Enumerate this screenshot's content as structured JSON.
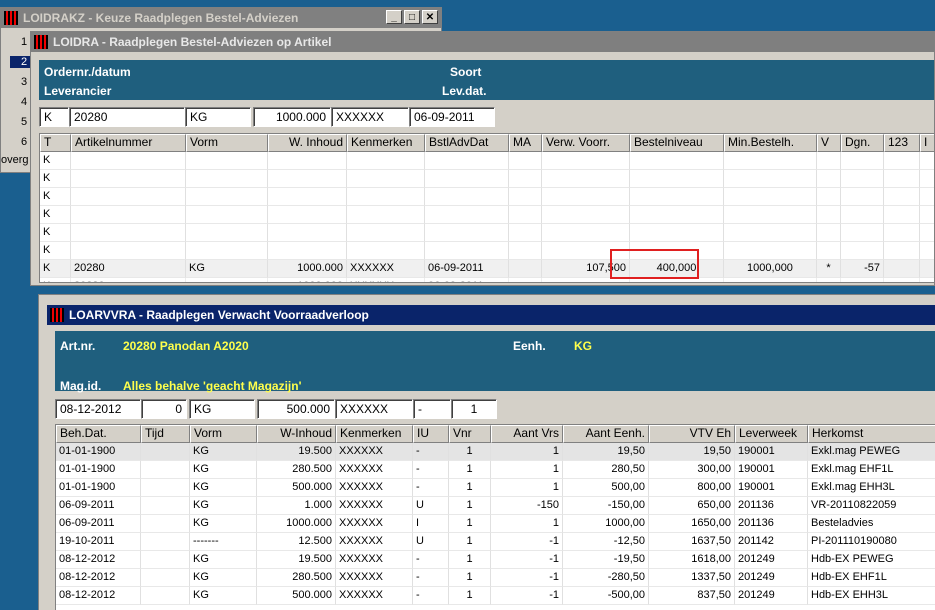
{
  "win_keuze": {
    "title": "LOIDRAKZ - Keuze Raadplegen Bestel-Adviezen",
    "side_numbers": [
      "1",
      "2",
      "3",
      "4",
      "5",
      "6"
    ],
    "side_text": "overg"
  },
  "win_loidra": {
    "title": "LOIDRA - Raadplegen Bestel-Adviezen op Artikel",
    "labels": {
      "ordernr": "Ordernr./datum",
      "leverancier": "Leverancier",
      "soort": "Soort",
      "levdat": "Lev.dat."
    },
    "fields": [
      "K",
      "20280",
      "KG",
      "1000.000",
      "XXXXXX",
      "06-09-2011"
    ],
    "columns": [
      "T",
      "Artikelnummer",
      "Vorm",
      "W. Inhoud",
      "Kenmerken",
      "BstlAdvDat",
      "MA",
      "Verw. Voorr.",
      "Bestelniveau",
      "Min.Bestelh.",
      "V",
      "Dgn.",
      "123",
      "I"
    ],
    "empty_rows": [
      "K",
      "K",
      "K",
      "K",
      "K",
      "K"
    ],
    "row": [
      "K",
      "20280",
      "KG",
      "1000.000",
      "XXXXXX",
      "06-09-2011",
      "",
      "107,500",
      "400,000",
      "1000,000",
      "*",
      "-57",
      "",
      ""
    ],
    "partial_row": [
      "K",
      "20280",
      "",
      "1000.000",
      "XXXXXX",
      "06-09-2011",
      "",
      "",
      "",
      "",
      "",
      "",
      "",
      ""
    ]
  },
  "win_loarvvra": {
    "title": "LOARVVRA - Raadplegen Verwacht Voorraadverloop",
    "labels": {
      "artnr": "Art.nr.",
      "artnr_value": "20280  Panodan A2020",
      "eenh": "Eenh.",
      "eenh_value": "KG",
      "magid": "Mag.id.",
      "magid_value": "Alles behalve 'geacht Magazijn'"
    },
    "fields": [
      "08-12-2012",
      "0",
      "KG",
      "500.000",
      "XXXXXX",
      "-",
      "1"
    ],
    "columns": [
      "Beh.Dat.",
      "Tijd",
      "Vorm",
      "W-Inhoud",
      "Kenmerken",
      "IU",
      "Vnr",
      "Aant Vrs",
      "Aant Eenh.",
      "VTV Eh",
      "Leverweek",
      "Herkomst"
    ],
    "rows": [
      [
        "01-01-1900",
        "",
        "KG",
        "19.500",
        "XXXXXX",
        "-",
        "1",
        "1",
        "19,50",
        "19,50",
        "190001",
        "Exkl.mag PEWEG"
      ],
      [
        "01-01-1900",
        "",
        "KG",
        "280.500",
        "XXXXXX",
        "-",
        "1",
        "1",
        "280,50",
        "300,00",
        "190001",
        "Exkl.mag EHF1L"
      ],
      [
        "01-01-1900",
        "",
        "KG",
        "500.000",
        "XXXXXX",
        "-",
        "1",
        "1",
        "500,00",
        "800,00",
        "190001",
        "Exkl.mag EHH3L"
      ],
      [
        "06-09-2011",
        "",
        "KG",
        "1.000",
        "XXXXXX",
        "U",
        "1",
        "-150",
        "-150,00",
        "650,00",
        "201136",
        "VR-20110822059"
      ],
      [
        "06-09-2011",
        "",
        "KG",
        "1000.000",
        "XXXXXX",
        "I",
        "1",
        "1",
        "1000,00",
        "1650,00",
        "201136",
        "Besteladvies"
      ],
      [
        "19-10-2011",
        "",
        "-------",
        "12.500",
        "XXXXXX",
        "U",
        "1",
        "-1",
        "-12,50",
        "1637,50",
        "201142",
        "PI-201110190080"
      ],
      [
        "08-12-2012",
        "",
        "KG",
        "19.500",
        "XXXXXX",
        "-",
        "1",
        "-1",
        "-19,50",
        "1618,00",
        "201249",
        "Hdb-EX PEWEG"
      ],
      [
        "08-12-2012",
        "",
        "KG",
        "280.500",
        "XXXXXX",
        "-",
        "1",
        "-1",
        "-280,50",
        "1337,50",
        "201249",
        "Hdb-EX EHF1L"
      ],
      [
        "08-12-2012",
        "",
        "KG",
        "500.000",
        "XXXXXX",
        "-",
        "1",
        "-1",
        "-500,00",
        "837,50",
        "201249",
        "Hdb-EX EHH3L"
      ]
    ]
  }
}
